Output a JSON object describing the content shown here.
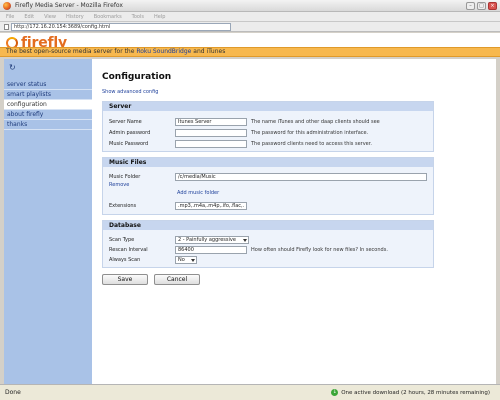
{
  "window": {
    "title": "Firefly Media Server - Mozilla Firefox"
  },
  "browser": {
    "menu": [
      "File",
      "Edit",
      "View",
      "History",
      "Bookmarks",
      "Tools",
      "Help"
    ],
    "url": "http://172.16.20.154:3689/config.html"
  },
  "brand": {
    "logo_text": "firefly",
    "tagline_prefix": "The best open-source media server for the ",
    "tagline_link": "Roku SoundBridge",
    "tagline_suffix": " and iTunes"
  },
  "sidebar": {
    "refresh_glyph": "↻",
    "items": [
      {
        "label": "server status"
      },
      {
        "label": "smart playlists"
      },
      {
        "label": "configuration"
      },
      {
        "label": "about firefly"
      },
      {
        "label": "thanks"
      }
    ]
  },
  "main": {
    "title": "Configuration",
    "advanced_link": "Show advanced config",
    "server": {
      "header": "Server",
      "name_label": "Server Name",
      "name_value": "Itunes Server",
      "name_note": "The name iTunes and other daap clients should see",
      "admin_label": "Admin password",
      "admin_value": "",
      "admin_note": "The password for this administration interface.",
      "music_pw_label": "Music Password",
      "music_pw_value": "",
      "music_pw_note": "The password clients need to access this server."
    },
    "music": {
      "header": "Music Files",
      "folder_label": "Music Folder",
      "folder_value": "/c/media/Music",
      "remove_link": "Remove",
      "add_link": "Add music folder",
      "ext_label": "Extensions",
      "ext_value": ".mp3,.m4a,.m4p,.ifo,.flac,."
    },
    "database": {
      "header": "Database",
      "scan_type_label": "Scan Type",
      "scan_type_value": "2 - Painfully aggressive",
      "rescan_label": "Rescan Interval",
      "rescan_value": "86400",
      "rescan_note": "How often should Firefly look for new files? In seconds.",
      "always_label": "Always Scan",
      "always_value": "No"
    },
    "save_label": "Save",
    "cancel_label": "Cancel"
  },
  "status": {
    "left": "Done",
    "right": "One active download (2 hours, 28 minutes remaining)"
  },
  "colors": {
    "sidebar": "#a9c2e7",
    "section_header": "#c7d6ef",
    "tagline": "#f7b84e",
    "logo": "#e36c1f"
  }
}
